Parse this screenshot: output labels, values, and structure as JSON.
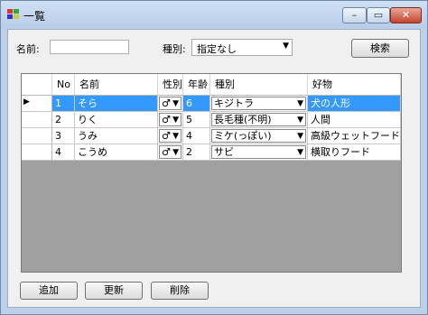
{
  "window": {
    "title": "一覧",
    "minimize_glyph": "–",
    "maximize_glyph": "▭",
    "close_glyph": "✕"
  },
  "search": {
    "name_label": "名前:",
    "name_value": "",
    "type_label": "種別:",
    "type_selected": "指定なし",
    "search_button": "検索"
  },
  "grid": {
    "columns": [
      "No",
      "名前",
      "性別",
      "年齢",
      "種別",
      "好物"
    ],
    "rows": [
      {
        "no": "1",
        "name": "そら",
        "gender": "♂",
        "age": "6",
        "type": "キジトラ",
        "favorite": "犬の人形"
      },
      {
        "no": "2",
        "name": "りく",
        "gender": "♂",
        "age": "5",
        "type": "長毛種(不明)",
        "favorite": "人間"
      },
      {
        "no": "3",
        "name": "うみ",
        "gender": "♂",
        "age": "4",
        "type": "ミケ(っぽい)",
        "favorite": "高級ウェットフード"
      },
      {
        "no": "4",
        "name": "こうめ",
        "gender": "♂",
        "age": "2",
        "type": "サビ",
        "favorite": "横取りフード"
      }
    ],
    "selected_row": 0,
    "current_row_marker": "▶"
  },
  "actions": {
    "add": "追加",
    "update": "更新",
    "delete": "削除"
  },
  "colors": {
    "selection": "#3399ff",
    "grid_background": "#a0a0a0"
  }
}
